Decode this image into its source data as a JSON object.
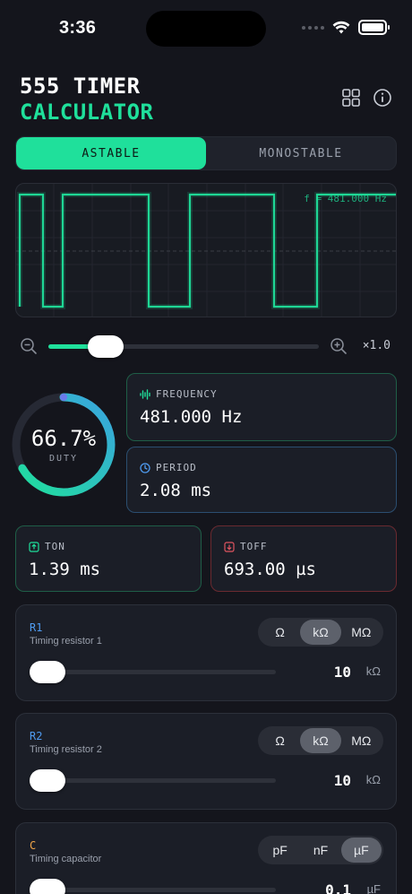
{
  "status": {
    "time": "3:36"
  },
  "header": {
    "title_line1": "555 TIMER",
    "title_line2": "CALCULATOR"
  },
  "mode": {
    "options": [
      "ASTABLE",
      "MONOSTABLE"
    ],
    "selected": "ASTABLE"
  },
  "scope": {
    "frequency_label": "f = 481.000 Hz"
  },
  "zoom": {
    "level": "×1.0",
    "position_fraction": 0.2
  },
  "duty": {
    "value": "66.7%",
    "label": "DUTY",
    "fraction": 0.667
  },
  "stats": {
    "frequency": {
      "label": "FREQUENCY",
      "value": "481.000 Hz"
    },
    "period": {
      "label": "PERIOD",
      "value": "2.08 ms"
    },
    "ton": {
      "label": "TON",
      "value": "1.39 ms"
    },
    "toff": {
      "label": "TOFF",
      "value": "693.00 µs"
    }
  },
  "components": {
    "r1": {
      "name": "R1",
      "desc": "Timing resistor 1",
      "units": [
        "Ω",
        "kΩ",
        "MΩ"
      ],
      "selected_unit": "kΩ",
      "value": "10",
      "unit": "kΩ"
    },
    "r2": {
      "name": "R2",
      "desc": "Timing resistor 2",
      "units": [
        "Ω",
        "kΩ",
        "MΩ"
      ],
      "selected_unit": "kΩ",
      "value": "10",
      "unit": "kΩ"
    },
    "c": {
      "name": "C",
      "desc": "Timing capacitor",
      "units": [
        "pF",
        "nF",
        "µF"
      ],
      "selected_unit": "µF",
      "value": "0.1",
      "unit": "µF"
    }
  },
  "colors": {
    "accent": "#1fe09b",
    "background": "#14151c",
    "r_label": "#4f9bf0",
    "c_label": "#f0a548"
  }
}
